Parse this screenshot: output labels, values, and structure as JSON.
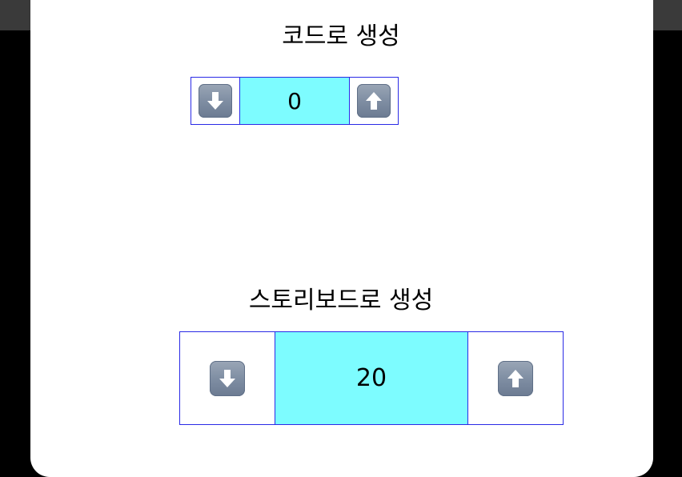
{
  "code_section": {
    "title": "코드로 생성",
    "stepper": {
      "value": "0",
      "decrement_icon": "down-arrow-icon",
      "increment_icon": "up-arrow-icon"
    }
  },
  "storyboard_section": {
    "title": "스토리보드로 생성",
    "stepper": {
      "value": "20",
      "decrement_icon": "down-arrow-icon",
      "increment_icon": "up-arrow-icon"
    }
  },
  "colors": {
    "value_background": "#7dfcff",
    "stepper_border": "#2a2ae6",
    "background": "#ffffff",
    "bezel": "#000000"
  }
}
